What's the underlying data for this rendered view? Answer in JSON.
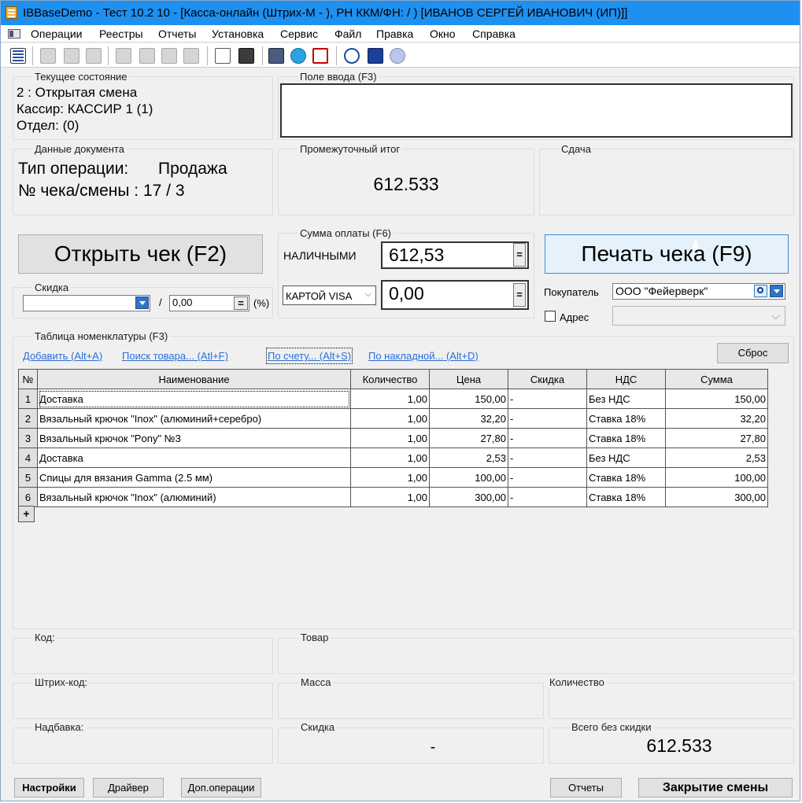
{
  "window": {
    "title": "IBBaseDemo - Тест 10.2 10 - [Касса-онлайн (Штрих-М - ), РН ККМ/ФН:  / )   [ИВАНОВ СЕРГЕЙ ИВАНОВИЧ (ИП)]]"
  },
  "menu": [
    "Операции",
    "Реестры",
    "Отчеты",
    "Установка",
    "Сервис",
    "Файл",
    "Правка",
    "Окно",
    "Справка"
  ],
  "state": {
    "legend": "Текущее состояние",
    "line1": "2 : Открытая смена",
    "line2": "Кассир: КАССИР 1 (1)",
    "line3": "Отдел:  (0)"
  },
  "input_field": {
    "legend": "Поле ввода (F3)",
    "value": ""
  },
  "document": {
    "legend": "Данные документа",
    "op_label": "Тип операции:",
    "op_value": "Продажа",
    "check_label": "№ чека/смены : 17 / 3"
  },
  "subtotal": {
    "legend": "Промежуточный итог",
    "value": "612.533"
  },
  "change": {
    "legend": "Сдача",
    "value": ""
  },
  "open_check_button": "Открыть чек (F2)",
  "print_check_button": "Печать чека (F9)",
  "payment": {
    "legend": "Сумма оплаты (F6)",
    "cash_label": "НАЛИЧНЫМИ",
    "cash_value": "612,53",
    "card_label": "КАРТОЙ VISA",
    "card_value": "0,00",
    "eq": "="
  },
  "discount": {
    "legend": "Скидка",
    "slash": "/",
    "value": "0,00",
    "eq": "=",
    "percent": "(%)"
  },
  "buyer": {
    "label": "Покупатель",
    "value": "ООО \"Фейерверк\"",
    "address_label": "Адрес"
  },
  "table": {
    "legend": "Таблица номенклатуры (F3)",
    "links": {
      "add": "Добавить (Alt+A)",
      "search": "Поиск товара... (Atl+F)",
      "by_invoice": "По счету... (Alt+S)",
      "by_waybill": "По накладной... (Alt+D)"
    },
    "reset_button": "Сброс",
    "columns": [
      "№",
      "Наименование",
      "Количество",
      "Цена",
      "Скидка",
      "НДС",
      "Сумма"
    ],
    "rows": [
      {
        "n": "1",
        "name": "Доставка",
        "qty": "1,00",
        "price": "150,00",
        "disc": "-",
        "vat": "Без НДС",
        "sum": "150,00"
      },
      {
        "n": "2",
        "name": "Вязальный крючок \"Inox\" (алюминий+серебро)",
        "qty": "1,00",
        "price": "32,20",
        "disc": "-",
        "vat": "Ставка 18%",
        "sum": "32,20"
      },
      {
        "n": "3",
        "name": "Вязальный крючок \"Pony\" №3",
        "qty": "1,00",
        "price": "27,80",
        "disc": "-",
        "vat": "Ставка 18%",
        "sum": "27,80"
      },
      {
        "n": "4",
        "name": "Доставка",
        "qty": "1,00",
        "price": "2,53",
        "disc": "-",
        "vat": "Без НДС",
        "sum": "2,53"
      },
      {
        "n": "5",
        "name": "Спицы для вязания Gamma (2.5 мм)",
        "qty": "1,00",
        "price": "100,00",
        "disc": "-",
        "vat": "Ставка 18%",
        "sum": "100,00"
      },
      {
        "n": "6",
        "name": "Вязальный крючок \"Inox\" (алюминий)",
        "qty": "1,00",
        "price": "300,00",
        "disc": "-",
        "vat": "Ставка 18%",
        "sum": "300,00"
      }
    ],
    "add_row": "+"
  },
  "details": {
    "code": "Код:",
    "product": "Товар",
    "barcode": "Штрих-код:",
    "mass": "Масса",
    "quantity": "Количество",
    "markup": "Надбавка:",
    "discount": "Скидка",
    "discount_value": "-",
    "total_no_disc": "Всего без скидки",
    "total_no_disc_value": "612.533"
  },
  "footer": {
    "settings": "Настройки",
    "driver": "Драйвер",
    "extra_ops": "Доп.операции",
    "reports": "Отчеты",
    "close_shift": "Закрытие смены"
  }
}
